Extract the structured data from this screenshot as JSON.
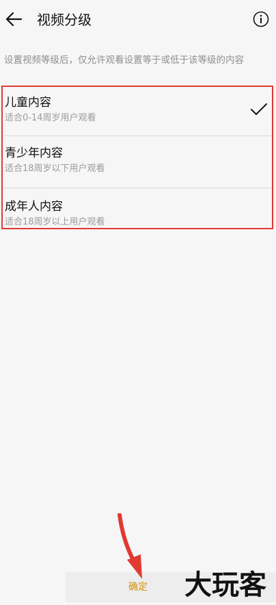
{
  "header": {
    "title": "视频分级",
    "back_icon": "arrow-left-icon",
    "info_icon": "info-circle-icon"
  },
  "description": "设置视频等级后，仅允许观看设置等于或低于该等级的内容",
  "options": [
    {
      "title": "儿童内容",
      "subtitle": "适合0-14周岁用户观看",
      "selected": true
    },
    {
      "title": "青少年内容",
      "subtitle": "适合18周岁以下用户观看",
      "selected": false
    },
    {
      "title": "成年人内容",
      "subtitle": "适合18周岁以上用户观看",
      "selected": false
    }
  ],
  "footer": {
    "confirm_label": "确定"
  },
  "watermark": "大玩客",
  "colors": {
    "highlight_border": "#e03a33",
    "confirm_text": "#d4900f",
    "background": "#f6f6f6"
  }
}
